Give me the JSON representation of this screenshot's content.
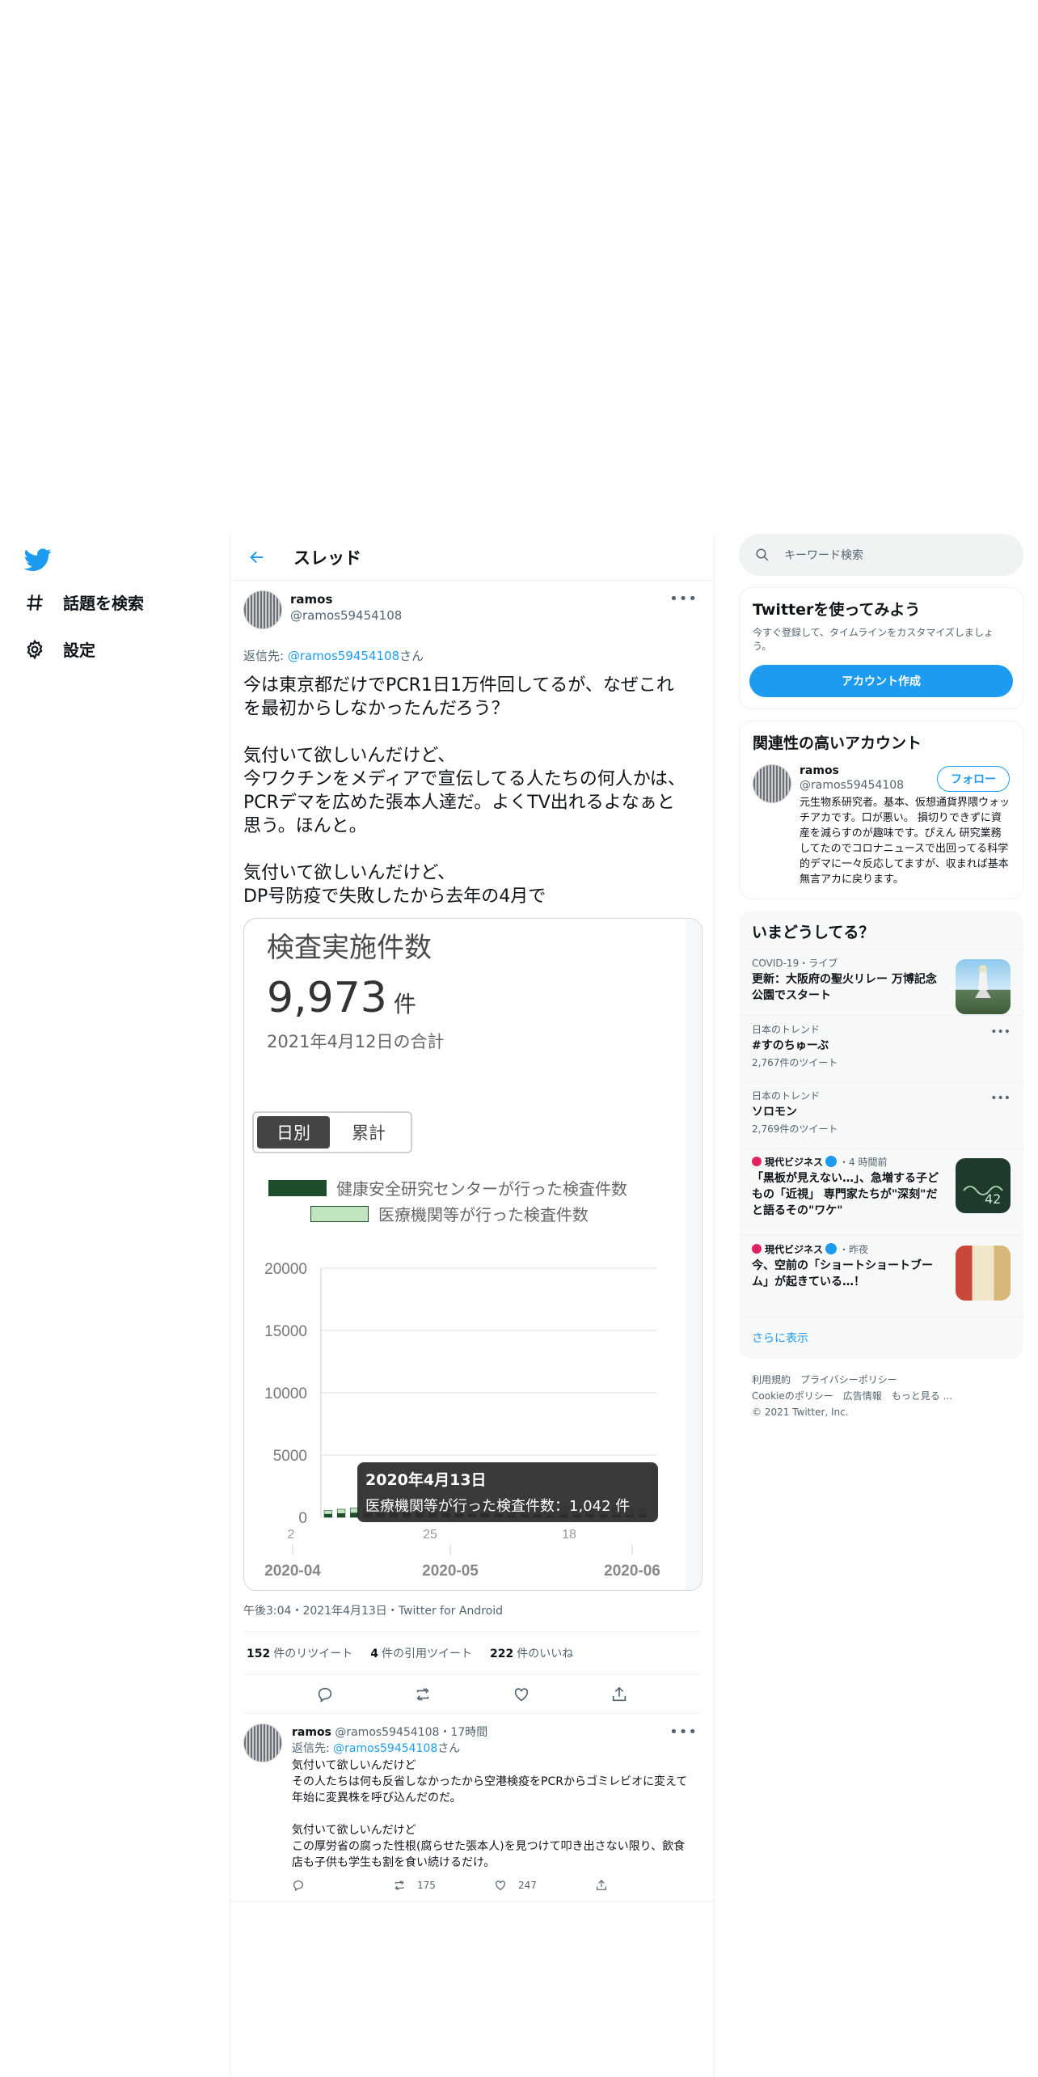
{
  "nav": {
    "explore": "話題を検索",
    "settings": "設定"
  },
  "header": {
    "title": "スレッド"
  },
  "main_tweet": {
    "name": "ramos",
    "handle": "@ramos59454108",
    "reply_prefix": "返信先: ",
    "reply_handle": "@ramos59454108",
    "reply_suffix": "さん",
    "text": "今は東京都だけでPCR1日1万件回してるが、なぜこれを最初からしなかったんだろう？\n\n気付いて欲しいんだけど、\n今ワクチンをメディアで宣伝してる人たちの何人かは、PCRデマを広めた張本人達だ。よくTV出れるよなぁと思う。ほんと。\n\n気付いて欲しいんだけど、\nDP号防疫で失敗したから去年の4月で",
    "meta": "午後3:04・2021年4月13日・Twitter for Android",
    "retweets": "152",
    "retweets_label": "件のリツイート",
    "quotes": "4",
    "quotes_label": "件の引用ツイート",
    "likes": "222",
    "likes_label": "件のいいね"
  },
  "media": {
    "title": "検査実施件数",
    "big_number": "9,973",
    "unit": "件",
    "date": "2021年4月12日の合計",
    "toggle_on": "日別",
    "toggle_off": "累計",
    "legend_1": "健康安全研究センターが行った検査件数",
    "legend_2": "医療機関等が行った検査件数",
    "legend_1_color": "#1d4d2b",
    "legend_2_color": "#c3e4c1",
    "tooltip_title": "2020年4月13日",
    "tooltip_text": "医療機関等が行った検査件数：1,042 件"
  },
  "chart_data": {
    "type": "bar",
    "y_ticks": [
      "20000",
      "15000",
      "10000",
      "5000",
      "0"
    ],
    "ylim": [
      0,
      20000
    ],
    "x_day_ticks": [
      "2",
      "25",
      "18"
    ],
    "x_month_ticks": [
      "2020-04",
      "2020-05",
      "2020-06"
    ],
    "series": [
      {
        "name": "健康安全研究センターが行った検査件数",
        "values": [
          250,
          300,
          350,
          280,
          300,
          350,
          400,
          380,
          320,
          300,
          280,
          260,
          300,
          250,
          200,
          220,
          200,
          180,
          200,
          190,
          210,
          200,
          180,
          170,
          160
        ]
      },
      {
        "name": "医療機関等が行った検査件数",
        "values": [
          300,
          350,
          400,
          500,
          600,
          700,
          800,
          900,
          1000,
          1042,
          950,
          900,
          850,
          800,
          780,
          760,
          700,
          650,
          620,
          600,
          580,
          560,
          540,
          520,
          500
        ]
      }
    ]
  },
  "reply": {
    "name": "ramos",
    "handle": "@ramos59454108",
    "time": "・17時間",
    "reply_prefix": "返信先: ",
    "reply_handle": "@ramos59454108",
    "reply_suffix": "さん",
    "text": "気付いて欲しいんだけど\nその人たちは何も反省しなかったから空港検疫をPCRからゴミレビオに変えて年始に変異株を呼び込んだのだ。\n\n気付いて欲しいんだけど\nこの厚労省の腐った性根(腐らせた張本人)を見つけて叩き出さない限り、飲食店も子供も学生も割を食い続けるだけ。",
    "retweets": "175",
    "likes": "247"
  },
  "search": {
    "placeholder": "キーワード検索"
  },
  "signup": {
    "title": "Twitterを使ってみよう",
    "sub": "今すぐ登録して、タイムラインをカスタマイズしましょう。",
    "button": "アカウント作成"
  },
  "related": {
    "title": "関連性の高いアカウント",
    "name": "ramos",
    "handle": "@ramos59454108",
    "follow": "フォロー",
    "bio": "元生物系研究者。基本、仮想通貨界隈ウォッチアカです。口が悪い。 損切りできずに資産を減らすのが趣味です。ぴえん 研究業務してたのでコロナニュースで出回ってる科学的デマに一々反応してますが、収まれば基本無言アカに戻ります。"
  },
  "trends": {
    "title": "いまどうしてる？",
    "items": [
      {
        "category": "COVID-19・ライブ",
        "name": "更新：大阪府の聖火リレー 万博記念公園でスタート",
        "count": ""
      },
      {
        "category": "日本のトレンド",
        "name": "#すのちゅーぶ",
        "count": "2,767件のツイート"
      },
      {
        "category": "日本のトレンド",
        "name": "ソロモン",
        "count": "2,769件のツイート"
      },
      {
        "category": "現代ビジネス",
        "time": "・4 時間前",
        "name": "「黒板が見えない…」、急増する子どもの「近視」 専門家たちが\"深刻\"だと語るその\"ワケ\"",
        "count": ""
      },
      {
        "category": "現代ビジネス",
        "time": "・昨夜",
        "name": "今、空前の「ショートショートブーム」が起きている…！",
        "count": ""
      }
    ],
    "show_more": "さらに表示"
  },
  "footer": {
    "terms": "利用規約",
    "privacy": "プライバシーポリシー",
    "cookie": "Cookieのポリシー",
    "ads": "広告情報",
    "more": "もっと見る ...",
    "copyright": "© 2021 Twitter, Inc."
  },
  "colors": {
    "accent": "#1d9bf0",
    "text": "#0f1419",
    "muted": "#536471"
  }
}
